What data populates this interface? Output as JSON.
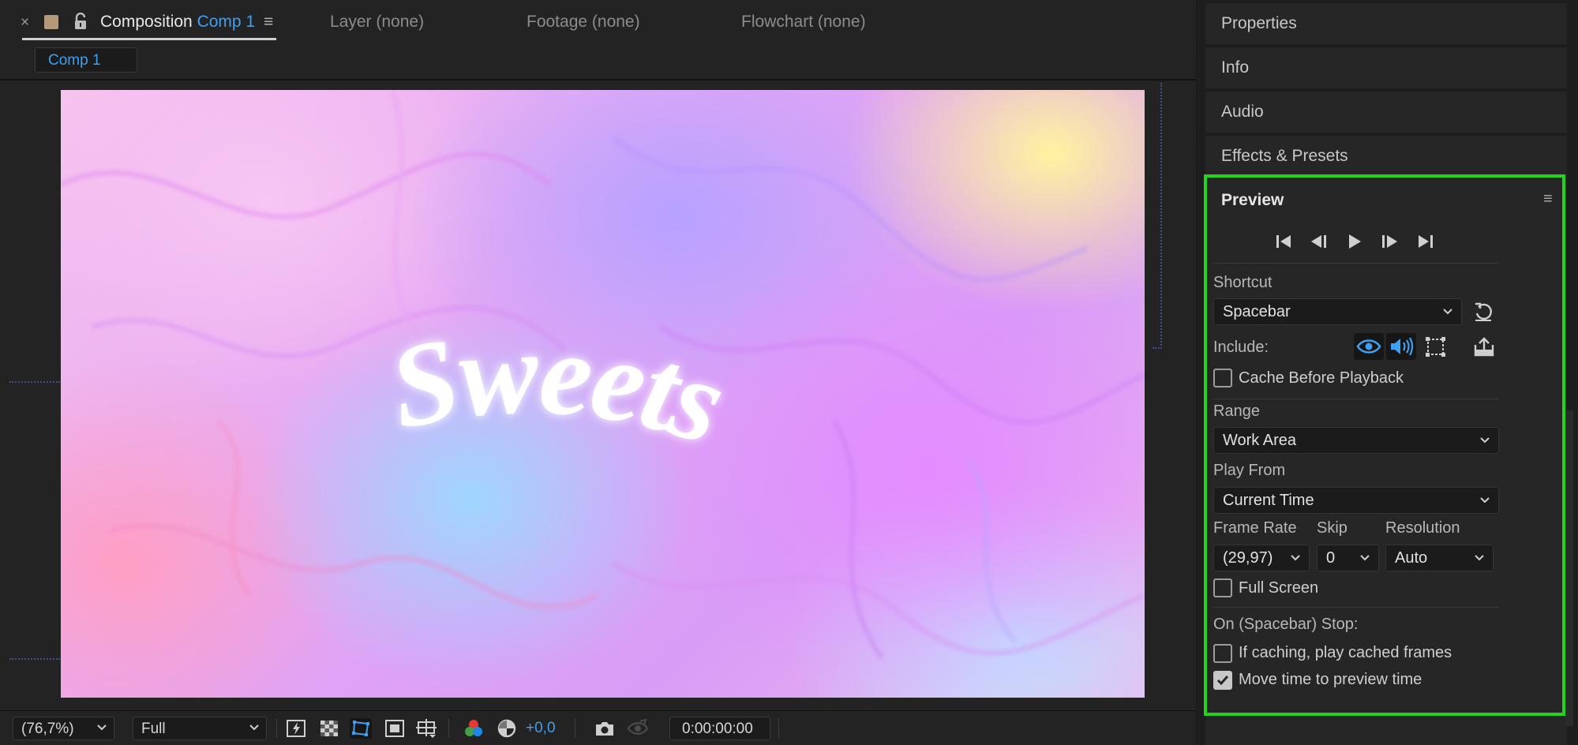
{
  "composition_panel": {
    "tab_label": "Composition",
    "tab_comp_name": "Comp 1",
    "other_tabs": [
      "Layer (none)",
      "Footage (none)",
      "Flowchart (none)"
    ],
    "comp_chip": "Comp 1",
    "canvas_text": "Sweets",
    "toolbar": {
      "zoom": "(76,7%)",
      "resolution": "Full",
      "exposure": "+0,0",
      "timecode": "0:00:00:00"
    }
  },
  "right_stack": {
    "properties": "Properties",
    "info": "Info",
    "audio": "Audio",
    "effects_presets": "Effects & Presets"
  },
  "preview": {
    "title": "Preview",
    "shortcut_label": "Shortcut",
    "shortcut_value": "Spacebar",
    "include_label": "Include:",
    "cache_before_playback": "Cache Before Playback",
    "range_label": "Range",
    "range_value": "Work Area",
    "play_from_label": "Play From",
    "play_from_value": "Current Time",
    "frame_rate_label": "Frame Rate",
    "frame_rate_value": "(29,97)",
    "skip_label": "Skip",
    "skip_value": "0",
    "resolution_label": "Resolution",
    "resolution_value": "Auto",
    "full_screen": "Full Screen",
    "on_stop_label": "On (Spacebar) Stop:",
    "if_caching": "If caching, play cached frames",
    "move_time": "Move time to preview time",
    "checkboxes": {
      "cache_before_playback": false,
      "full_screen": false,
      "if_caching": false,
      "move_time": true
    }
  },
  "colors": {
    "accent_blue": "#3ea0f0",
    "highlight_outline": "#22d41b",
    "panel_bg": "#262626",
    "field_bg": "#1b1b1b"
  },
  "icons": [
    "close-icon",
    "lock-icon",
    "menu-icon",
    "chevron-down-icon",
    "first-frame-icon",
    "previous-frame-icon",
    "play-icon",
    "next-frame-icon",
    "last-frame-icon",
    "reset-icon",
    "eye-icon",
    "speaker-icon",
    "overlay-icon",
    "export-icon",
    "fast-preview-icon",
    "transparency-grid-icon",
    "mask-visibility-icon",
    "region-of-interest-icon",
    "guides-icon",
    "color-channels-icon",
    "exposure-reset-icon",
    "snapshot-camera-icon",
    "show-snapshot-icon"
  ]
}
